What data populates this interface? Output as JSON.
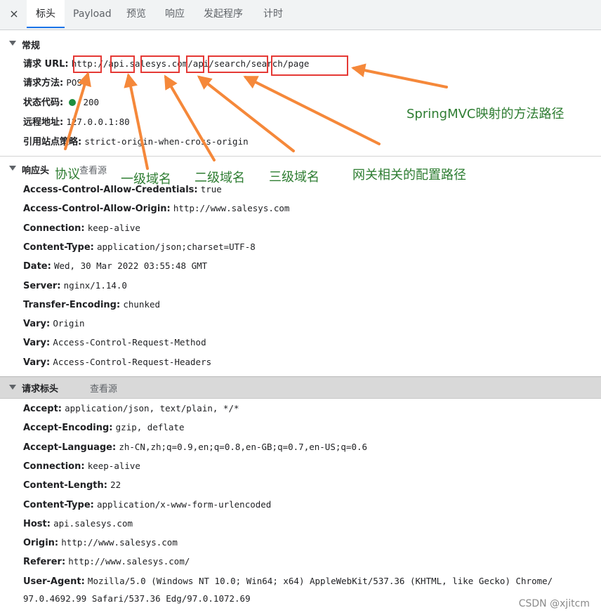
{
  "tabs": [
    {
      "label": "标头"
    },
    {
      "label": "Payload"
    },
    {
      "label": "预览"
    },
    {
      "label": "响应"
    },
    {
      "label": "发起程序"
    },
    {
      "label": "计时"
    }
  ],
  "close_icon": "×",
  "general": {
    "title": "常规",
    "rows": [
      {
        "key": "请求 URL:",
        "value": "http://api.salesys.com/api/search/search/page"
      },
      {
        "key": "请求方法:",
        "value": "POST"
      },
      {
        "key": "状态代码:",
        "value": "200"
      },
      {
        "key": "远程地址:",
        "value": "127.0.0.1:80"
      },
      {
        "key": "引用站点策略:",
        "value": "strict-origin-when-cross-origin"
      }
    ]
  },
  "response_headers": {
    "title": "响应头",
    "view_source": "查看源",
    "rows": [
      {
        "key": "Access-Control-Allow-Credentials:",
        "value": "true"
      },
      {
        "key": "Access-Control-Allow-Origin:",
        "value": "http://www.salesys.com"
      },
      {
        "key": "Connection:",
        "value": "keep-alive"
      },
      {
        "key": "Content-Type:",
        "value": "application/json;charset=UTF-8"
      },
      {
        "key": "Date:",
        "value": "Wed, 30 Mar 2022 03:55:48 GMT"
      },
      {
        "key": "Server:",
        "value": "nginx/1.14.0"
      },
      {
        "key": "Transfer-Encoding:",
        "value": "chunked"
      },
      {
        "key": "Vary:",
        "value": "Origin"
      },
      {
        "key": "Vary:",
        "value": "Access-Control-Request-Method"
      },
      {
        "key": "Vary:",
        "value": "Access-Control-Request-Headers"
      }
    ]
  },
  "request_headers": {
    "title": "请求标头",
    "view_source": "查看源",
    "rows": [
      {
        "key": "Accept:",
        "value": "application/json, text/plain, */*"
      },
      {
        "key": "Accept-Encoding:",
        "value": "gzip, deflate"
      },
      {
        "key": "Accept-Language:",
        "value": "zh-CN,zh;q=0.9,en;q=0.8,en-GB;q=0.7,en-US;q=0.6"
      },
      {
        "key": "Connection:",
        "value": "keep-alive"
      },
      {
        "key": "Content-Length:",
        "value": "22"
      },
      {
        "key": "Content-Type:",
        "value": "application/x-www-form-urlencoded"
      },
      {
        "key": "Host:",
        "value": "api.salesys.com"
      },
      {
        "key": "Origin:",
        "value": "http://www.salesys.com"
      },
      {
        "key": "Referer:",
        "value": "http://www.salesys.com/"
      },
      {
        "key": "User-Agent:",
        "value": "Mozilla/5.0 (Windows NT 10.0; Win64; x64) AppleWebKit/537.36 (KHTML, like Gecko) Chrome/"
      }
    ],
    "user_agent_cont": "97.0.4692.99 Safari/537.36 Edg/97.0.1072.69"
  },
  "annotations": {
    "protocol": "协议",
    "first_level": "一级域名",
    "second_level": "二级域名",
    "third_level": "三级域名",
    "gateway_path": "网关相关的配置路径",
    "springmvc_path": "SpringMVC映射的方法路径"
  },
  "watermark": "CSDN @xjitcm",
  "colors": {
    "annotation_green": "#2e7d32",
    "arrow_orange": "#f5883a",
    "box_red": "#e53935",
    "status_green": "#1e8e3e",
    "active_tab_underline": "#1a73e8"
  }
}
